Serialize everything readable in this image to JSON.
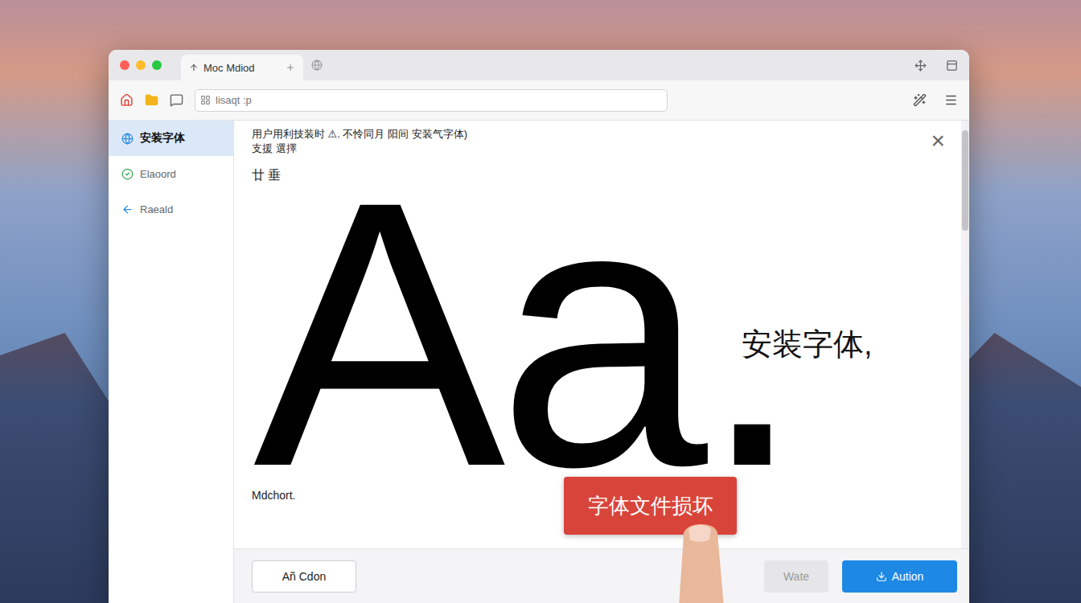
{
  "window": {
    "tab_title": "Moc Mdiod",
    "address": "lisaqt :p"
  },
  "sidebar": {
    "items": [
      {
        "label": "安装字体",
        "selected": true
      },
      {
        "label": "Elaoord",
        "selected": false
      },
      {
        "label": "Raeald",
        "selected": false
      }
    ]
  },
  "dialog": {
    "header": [
      "用户用利技装时 ⚠. 不怜同月 阳间 安装气字体)",
      "支援 選擇"
    ],
    "subtitle": "廿 垂",
    "close": "×",
    "sample": "Aa.",
    "caption": "安装字体,",
    "footnote": "Mdchort.",
    "error_badge": "字体文件损坏"
  },
  "buttons": [
    {
      "label": "Añ Cdon",
      "kind": "outline",
      "disabled": false
    },
    {
      "label": "Wate",
      "kind": "plain",
      "disabled": true
    },
    {
      "label": "Aution",
      "kind": "primary",
      "disabled": false
    }
  ]
}
